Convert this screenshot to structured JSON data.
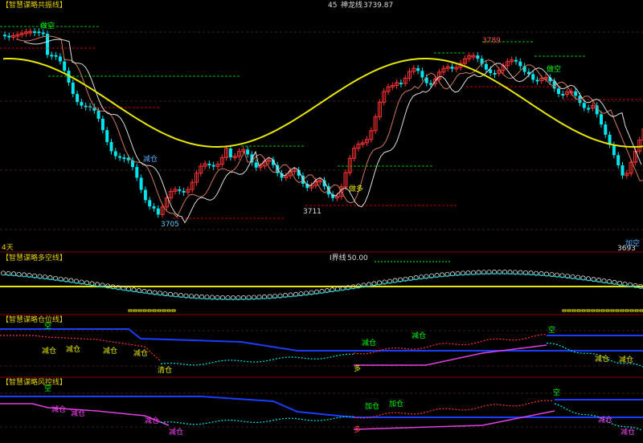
{
  "header": {
    "panel_title": "【智慧谋略共振线】",
    "period": "45",
    "indicator_name": "神龙线",
    "indicator_value": "3739.87"
  },
  "main_panel": {
    "corner_label": "4天",
    "price_labels": {
      "p1": "3789",
      "p2": "3705",
      "p3": "3711",
      "p4": "3693"
    },
    "signals": {
      "s1": "做空",
      "s2": "减仓",
      "s3": "做多",
      "s4": "做空",
      "s5": "加空"
    }
  },
  "panel2": {
    "title": "【智慧谋略多空线】",
    "subtitle": "I界线",
    "subtitle_value": "50.00"
  },
  "panel3": {
    "title": "【智慧谋略仓位线】",
    "signals": {
      "a": "空",
      "b": "减仓",
      "c": "减仓",
      "d": "减仓",
      "e": "减仓",
      "f": "清仓",
      "g": "减仓",
      "h": "减仓",
      "i": "多",
      "j": "空",
      "k": "减仓",
      "l": "减仓"
    }
  },
  "panel4": {
    "title": "【智慧谋略风控线】",
    "signals": {
      "a": "空",
      "b": "减仓",
      "c": "减仓",
      "d": "减仓",
      "e": "减仓",
      "f": "加仓",
      "g": "加仓",
      "h": "多",
      "i": "空",
      "j": "减仓",
      "k": "减仓"
    }
  },
  "colors": {
    "up": "#ff3333",
    "down": "#00e5ee",
    "accent_yellow": "#e8e800",
    "blue": "#1a3cff",
    "magenta": "#e040e0",
    "green_dash": "#00c000",
    "red_dash": "#c00000"
  },
  "chart_data": [
    {
      "type": "candlestick",
      "series": [
        {
          "name": "神龙线",
          "last": 3739.87
        }
      ],
      "marked_prices": [
        3789,
        3705,
        3711,
        3693
      ],
      "price_range": [
        3693,
        3789
      ]
    },
    {
      "type": "line",
      "reference_line": 50.0
    },
    {
      "type": "line"
    },
    {
      "type": "line"
    }
  ]
}
